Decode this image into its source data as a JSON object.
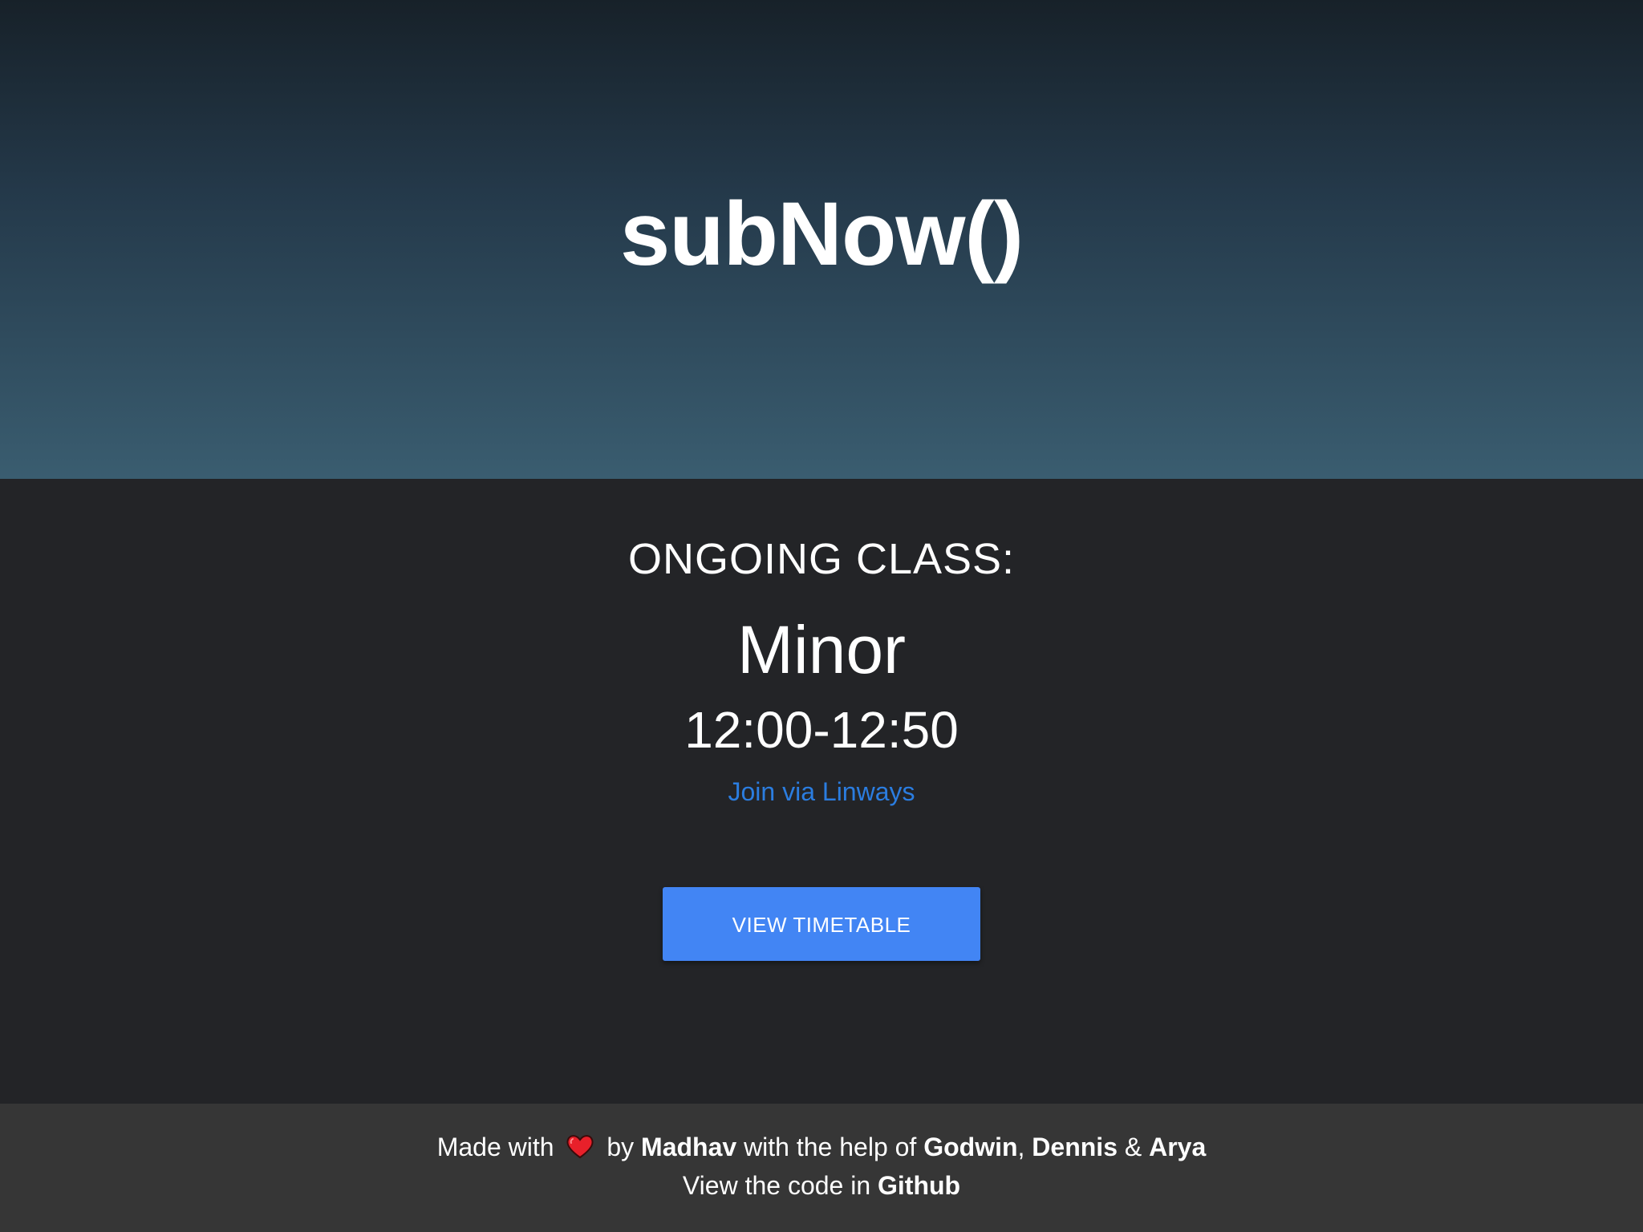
{
  "header": {
    "title": "subNow()"
  },
  "main": {
    "ongoing_label": "ONGOING CLASS:",
    "class_name": "Minor",
    "class_time": "12:00-12:50",
    "join_link": "Join via Linways",
    "timetable_button": "VIEW TIMETABLE"
  },
  "footer": {
    "made_with": "Made with",
    "heart_icon": "heart-icon",
    "by": "by",
    "author": "Madhav",
    "help_text": "with the help of",
    "helper1": "Godwin",
    "comma": ",",
    "helper2": "Dennis",
    "amp": "&",
    "helper3": "Arya",
    "view_code": "View the code in",
    "github": "Github"
  },
  "colors": {
    "header_top": "#172129",
    "header_bottom": "#3a5d70",
    "background": "#232427",
    "footer": "#363636",
    "link": "#2b7de0",
    "button": "#4285f4"
  }
}
